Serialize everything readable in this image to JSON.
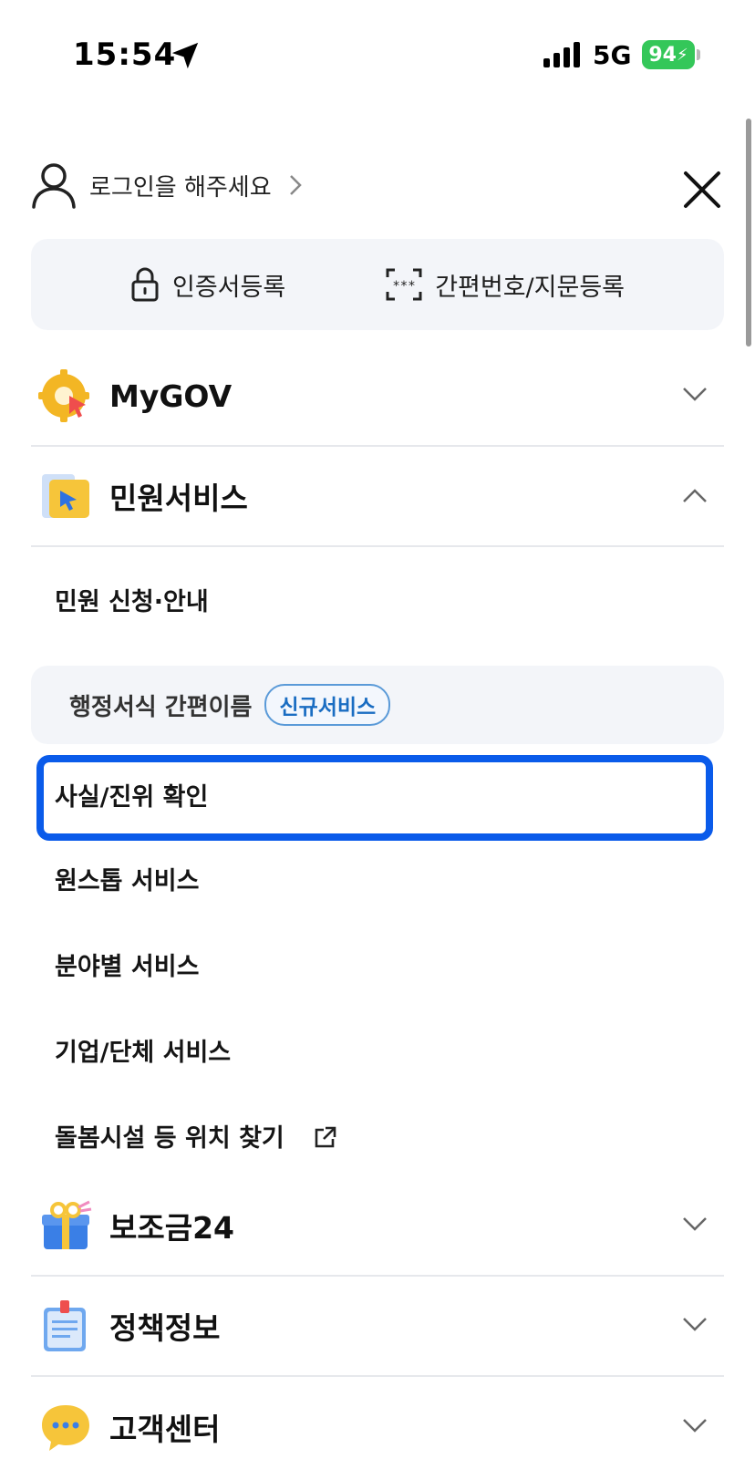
{
  "status_bar": {
    "time": "15:54",
    "network": "5G",
    "battery": "94"
  },
  "header": {
    "login_label": "로그인을 해주세요"
  },
  "cert": {
    "register_cert": "인증서등록",
    "register_pin": "간편번호/지문등록"
  },
  "menu": {
    "mygov": "MyGOV",
    "civil": "민원서비스",
    "subsidy": "보조금24",
    "policy": "정책정보",
    "support": "고객센터"
  },
  "civil_sub": {
    "apply": "민원 신청·안내",
    "easy_name": "행정서식 간편이름",
    "new_badge": "신규서비스",
    "verify": "사실/진위 확인",
    "onestop": "원스톱 서비스",
    "by_field": "분야별 서비스",
    "corp": "기업/단체 서비스",
    "care": "돌봄시설 등 위치 찾기"
  },
  "colors": {
    "highlight": "#0a5bea",
    "battery": "#34c759",
    "badge": "#1a6dc2"
  }
}
